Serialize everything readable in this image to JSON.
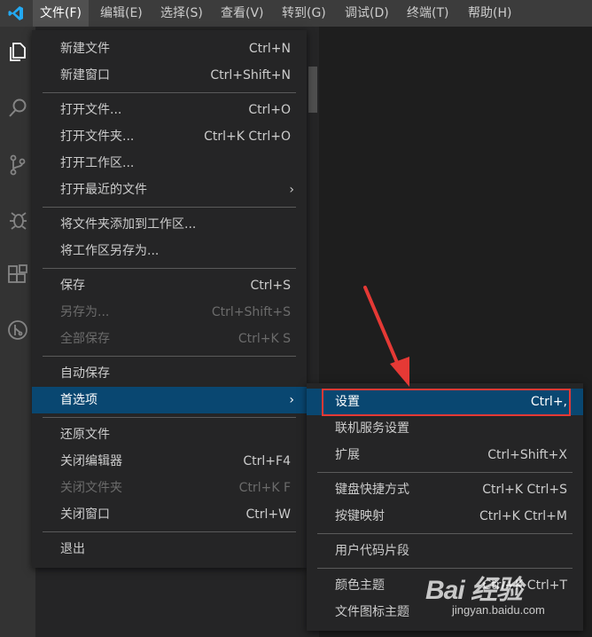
{
  "menubar": {
    "items": [
      {
        "label": "文件(F)",
        "active": true
      },
      {
        "label": "编辑(E)"
      },
      {
        "label": "选择(S)"
      },
      {
        "label": "查看(V)"
      },
      {
        "label": "转到(G)"
      },
      {
        "label": "调试(D)"
      },
      {
        "label": "终端(T)"
      },
      {
        "label": "帮助(H)"
      }
    ]
  },
  "activitybar": {
    "icons": [
      "explorer-icon",
      "search-icon",
      "source-control-icon",
      "debug-icon",
      "extensions-icon",
      "remote-icon"
    ]
  },
  "file_menu": {
    "items": [
      {
        "label": "新建文件",
        "shortcut": "Ctrl+N"
      },
      {
        "label": "新建窗口",
        "shortcut": "Ctrl+Shift+N"
      },
      {
        "label": "打开文件...",
        "shortcut": "Ctrl+O"
      },
      {
        "label": "打开文件夹...",
        "shortcut": "Ctrl+K Ctrl+O"
      },
      {
        "label": "打开工作区...",
        "shortcut": ""
      },
      {
        "label": "打开最近的文件",
        "shortcut": "",
        "submenu": true
      },
      {
        "label": "将文件夹添加到工作区...",
        "shortcut": ""
      },
      {
        "label": "将工作区另存为...",
        "shortcut": ""
      },
      {
        "label": "保存",
        "shortcut": "Ctrl+S"
      },
      {
        "label": "另存为...",
        "shortcut": "Ctrl+Shift+S",
        "disabled": true
      },
      {
        "label": "全部保存",
        "shortcut": "Ctrl+K S",
        "disabled": true
      },
      {
        "label": "自动保存",
        "shortcut": ""
      },
      {
        "label": "首选项",
        "shortcut": "",
        "submenu": true,
        "highlighted": true
      },
      {
        "label": "还原文件",
        "shortcut": ""
      },
      {
        "label": "关闭编辑器",
        "shortcut": "Ctrl+F4"
      },
      {
        "label": "关闭文件夹",
        "shortcut": "Ctrl+K F",
        "disabled": true
      },
      {
        "label": "关闭窗口",
        "shortcut": "Ctrl+W"
      },
      {
        "label": "退出",
        "shortcut": ""
      }
    ]
  },
  "preferences_menu": {
    "items": [
      {
        "label": "设置",
        "shortcut": "Ctrl+,",
        "highlighted": true
      },
      {
        "label": "联机服务设置",
        "shortcut": ""
      },
      {
        "label": "扩展",
        "shortcut": "Ctrl+Shift+X"
      },
      {
        "label": "键盘快捷方式",
        "shortcut": "Ctrl+K Ctrl+S"
      },
      {
        "label": "按键映射",
        "shortcut": "Ctrl+K Ctrl+M"
      },
      {
        "label": "用户代码片段",
        "shortcut": ""
      },
      {
        "label": "颜色主题",
        "shortcut": "Ctrl+K Ctrl+T"
      },
      {
        "label": "文件图标主题",
        "shortcut": ""
      }
    ]
  },
  "submenu_chevron": "›",
  "watermark": {
    "brand": "Bai 经验",
    "url": "jingyan.baidu.com"
  },
  "colors": {
    "highlight": "#094771",
    "menu_bg": "#252526",
    "annotation": "#e53935",
    "vscode_blue": "#23a9f2"
  }
}
